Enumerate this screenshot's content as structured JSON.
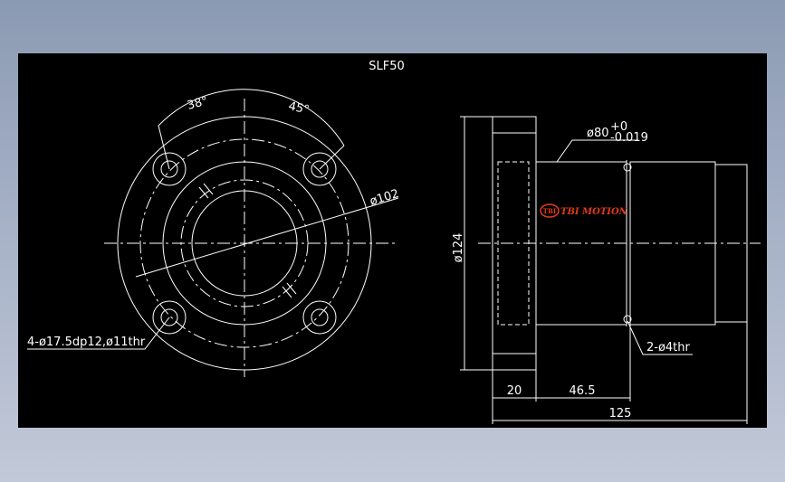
{
  "title": "SLF50",
  "brand": {
    "text": "TBI MOTION",
    "color": "#e23b1a"
  },
  "dims": {
    "angle_left": "38°",
    "angle_right": "45°",
    "pcd": "ø102",
    "holes": "4-ø17.5dp12,ø11thr",
    "od_pre": "ø80",
    "tol_upper": "+0",
    "tol_lower": "-0.019",
    "flange_dia": "ø124",
    "grease": "2-ø4thr",
    "flange_thk": "20",
    "length_46": "46.5",
    "length_total": "125"
  }
}
